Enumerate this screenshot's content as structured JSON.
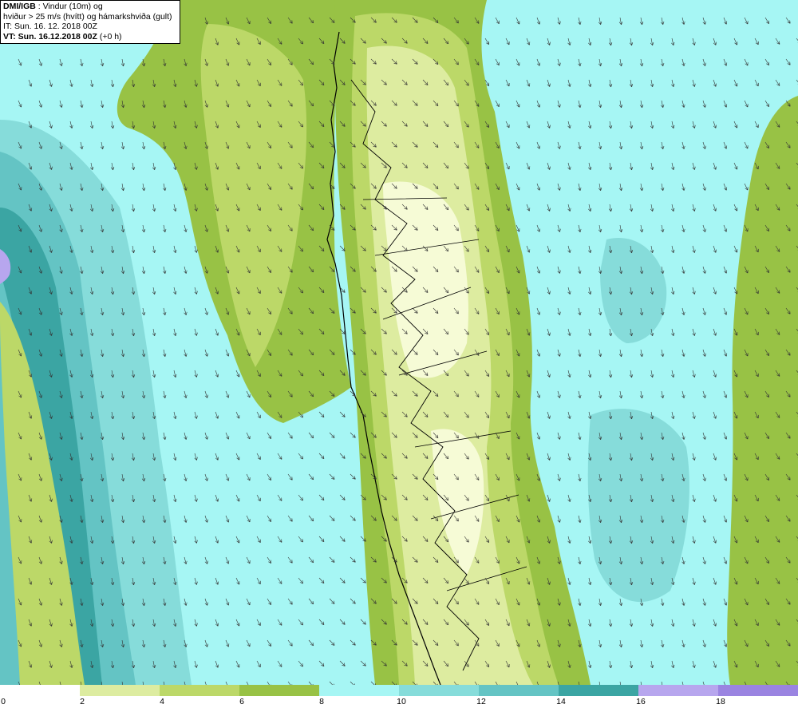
{
  "header": {
    "title_bold": "DMI/IGB",
    "title_rest": " : Vindur (10m) og",
    "line2": "hviður > 25 m/s (hvítt) og hámarkshviða (gult)",
    "line3": "IT: Sun. 16. 12. 2018 00Z",
    "line4_bold": "VT: Sun. 16.12.2018 00Z",
    "line4_rest": " (+0 h)"
  },
  "legend": {
    "colors": [
      "#ffffff",
      "#ddeca0",
      "#bcd868",
      "#98c245",
      "#a6f6f4",
      "#86dcda",
      "#64c4c4",
      "#3ba5a3",
      "#b7a6ee",
      "#9a84e1"
    ],
    "labels": [
      "0",
      "2",
      "4",
      "6",
      "8",
      "10",
      "12",
      "14",
      "16",
      "18"
    ]
  },
  "map": {
    "wind_direction": "south-southeast",
    "colors": {
      "ocean_light": "#a6f6f4",
      "ocean_mid": "#86dcda",
      "ocean_dark": "#64c4c4",
      "ocean_deep": "#3ba5a3",
      "land_light": "#f6fbd6",
      "land_mid": "#ddeca0",
      "land_green": "#bcd868",
      "land_dark": "#98c245",
      "purple": "#b7a6ee",
      "coast": "#000000"
    }
  }
}
